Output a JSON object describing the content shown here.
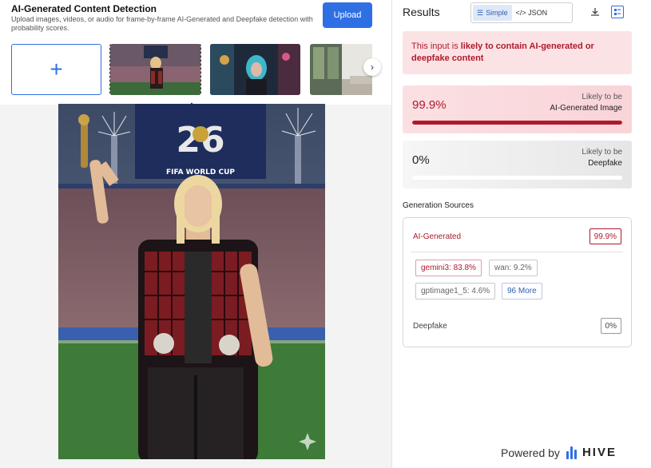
{
  "header": {
    "title": "AI-Generated Content Detection",
    "subtitle": "Upload images, videos, or audio for frame-by-frame AI-Generated and Deepfake detection with probability scores.",
    "upload_label": "Upload"
  },
  "thumbnails": {
    "add_icon": "+",
    "next_icon": "›",
    "collapse_icon": "⌃"
  },
  "results": {
    "title": "Results",
    "view_simple": "Simple",
    "view_json": "</> JSON",
    "alert_prefix": "This input is ",
    "alert_emphasis": "likely to contain AI-generated or deepfake content",
    "ai_score": "99.9%",
    "ai_score_fraction": 0.999,
    "ai_label_top": "Likely to be",
    "ai_label_main": "AI-Generated Image",
    "df_score": "0%",
    "df_score_fraction": 0.0,
    "df_label_top": "Likely to be",
    "df_label_main": "Deepfake"
  },
  "generation_sources": {
    "title": "Generation Sources",
    "ai_label": "AI-Generated",
    "ai_score": "99.9%",
    "tags": [
      "gemini3: 83.8%",
      "wan: 9.2%",
      "gptimage1_5: 4.6%",
      "96 More"
    ],
    "deepfake_label": "Deepfake",
    "deepfake_score": "0%"
  },
  "footer": {
    "powered_by": "Powered by",
    "brand": "HIVE"
  },
  "colors": {
    "accent_blue": "#2f6fe4",
    "alert_red": "#b0192c",
    "alert_bg": "#fbe3e5"
  }
}
